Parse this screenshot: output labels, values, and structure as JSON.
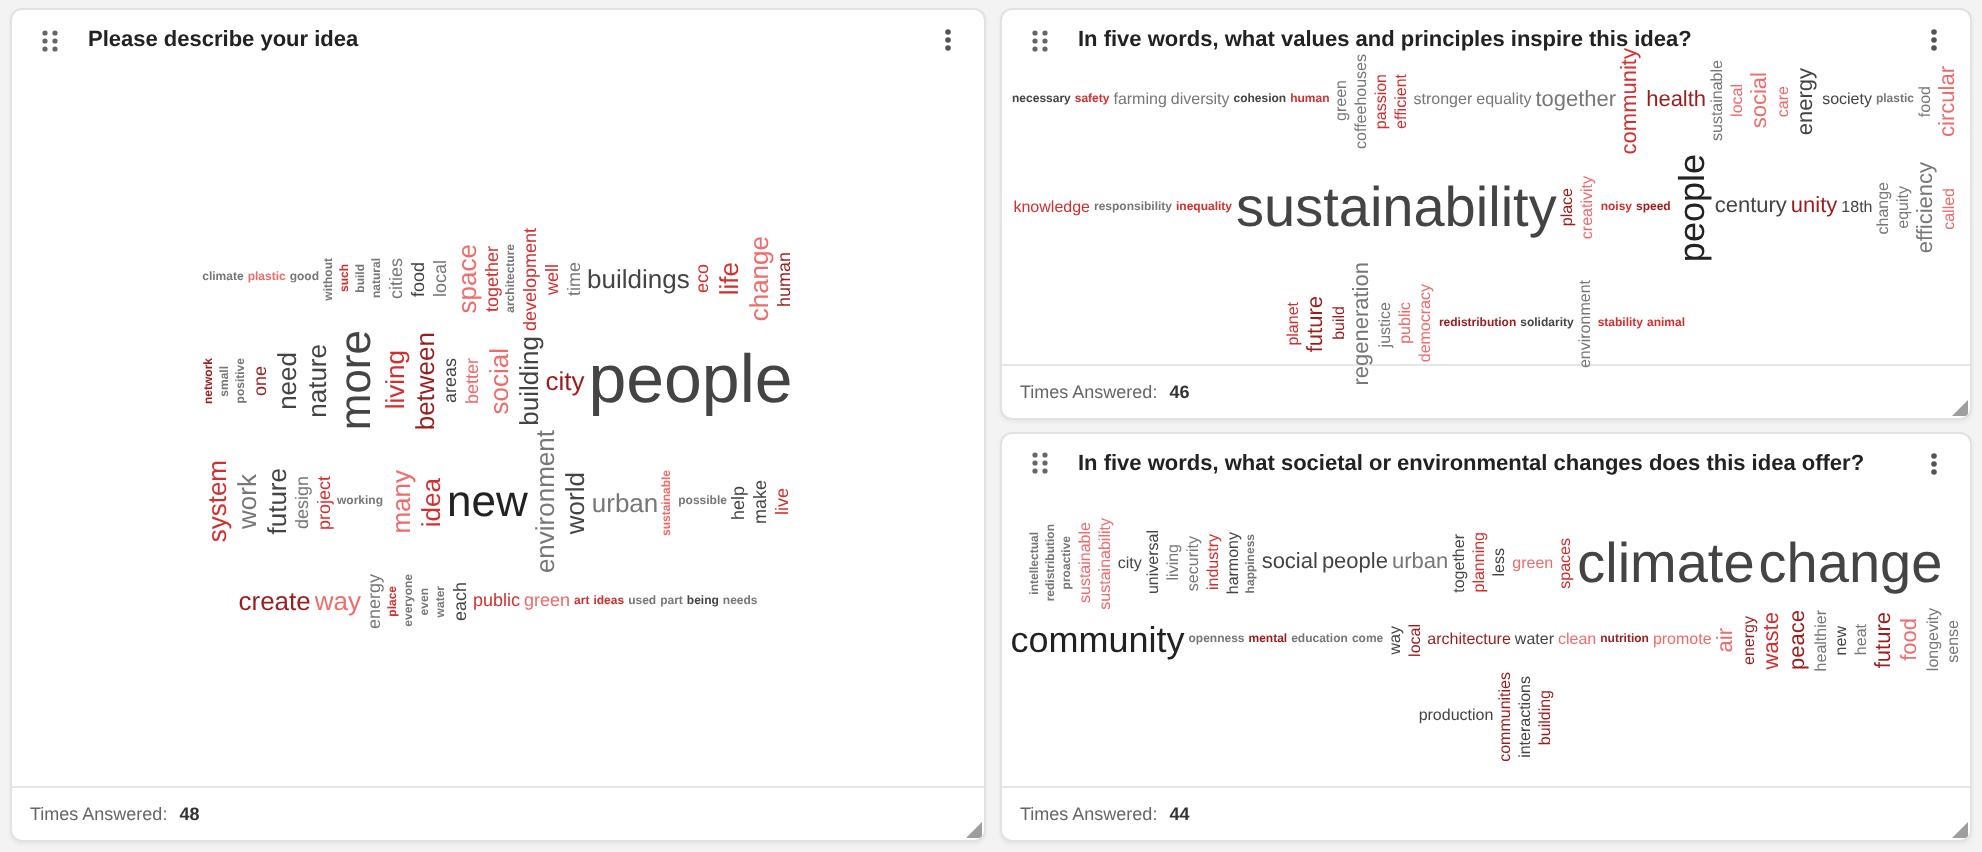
{
  "cards": [
    {
      "title": "Please describe your idea",
      "answered_label": "Times Answered:",
      "answered_count": "48",
      "words": [
        {
          "text": "climate",
          "kind": "xs",
          "vertical": false,
          "color": "#777777"
        },
        {
          "text": "plastic",
          "kind": "xs",
          "vertical": false,
          "color": "#ef6c6c"
        },
        {
          "text": "good",
          "kind": "xs",
          "vertical": false,
          "color": "#777777"
        },
        {
          "text": "without",
          "kind": "xs",
          "vertical": true,
          "color": "#777777"
        },
        {
          "text": "such",
          "kind": "xs",
          "vertical": true,
          "color": "#d32f2f"
        },
        {
          "text": "build",
          "kind": "xs",
          "vertical": true,
          "color": "#777777"
        },
        {
          "text": "natural",
          "kind": "xs",
          "vertical": true,
          "color": "#777777"
        },
        {
          "text": "cities",
          "kind": "s",
          "vertical": true,
          "color": "#777777"
        },
        {
          "text": "food",
          "kind": "s",
          "vertical": true,
          "color": "#444444"
        },
        {
          "text": "local",
          "kind": "s",
          "vertical": true,
          "color": "#777777"
        },
        {
          "text": "space",
          "kind": "m",
          "vertical": true,
          "color": "#ef6c6c"
        },
        {
          "text": "together",
          "kind": "s",
          "vertical": true,
          "color": "#d32f2f"
        },
        {
          "text": "architecture",
          "kind": "xs",
          "vertical": true,
          "color": "#777777"
        },
        {
          "text": "development",
          "kind": "s",
          "vertical": true,
          "color": "#d32f2f"
        },
        {
          "text": "well",
          "kind": "s",
          "vertical": true,
          "color": "#d32f2f"
        },
        {
          "text": "time",
          "kind": "s",
          "vertical": true,
          "color": "#777777"
        },
        {
          "text": "buildings",
          "kind": "m",
          "vertical": false,
          "color": "#444444"
        },
        {
          "text": "eco",
          "kind": "s",
          "vertical": true,
          "color": "#d32f2f"
        },
        {
          "text": "life",
          "kind": "m",
          "vertical": true,
          "color": "#d32f2f"
        },
        {
          "text": "change",
          "kind": "m",
          "vertical": true,
          "color": "#ef6c6c"
        },
        {
          "text": "human",
          "kind": "s",
          "vertical": true,
          "color": "#9b1c1c"
        },
        {
          "text": "network",
          "kind": "xs",
          "vertical": true,
          "color": "#9b1c1c"
        },
        {
          "text": "small",
          "kind": "xs",
          "vertical": true,
          "color": "#777777"
        },
        {
          "text": "positive",
          "kind": "xs",
          "vertical": true,
          "color": "#777777"
        },
        {
          "text": "one",
          "kind": "s",
          "vertical": true,
          "color": "#9b1c1c"
        },
        {
          "text": "need",
          "kind": "m",
          "vertical": true,
          "color": "#444444"
        },
        {
          "text": "nature",
          "kind": "m",
          "vertical": true,
          "color": "#444444"
        },
        {
          "text": "more",
          "kind": "l",
          "vertical": true,
          "color": "#444444"
        },
        {
          "text": "living",
          "kind": "m",
          "vertical": true,
          "color": "#d32f2f"
        },
        {
          "text": "between",
          "kind": "m",
          "vertical": true,
          "color": "#9b1c1c"
        },
        {
          "text": "areas",
          "kind": "s",
          "vertical": true,
          "color": "#444444"
        },
        {
          "text": "better",
          "kind": "s",
          "vertical": true,
          "color": "#ef6c6c"
        },
        {
          "text": "social",
          "kind": "m",
          "vertical": true,
          "color": "#ef6c6c"
        },
        {
          "text": "building",
          "kind": "m",
          "vertical": true,
          "color": "#444444"
        },
        {
          "text": "city",
          "kind": "m",
          "vertical": false,
          "color": "#9b1c1c"
        },
        {
          "text": "people",
          "kind": "xl",
          "vertical": false,
          "color": "#444444"
        },
        {
          "text": "system",
          "kind": "m",
          "vertical": true,
          "color": "#d32f2f"
        },
        {
          "text": "work",
          "kind": "m",
          "vertical": true,
          "color": "#777777"
        },
        {
          "text": "future",
          "kind": "m",
          "vertical": true,
          "color": "#444444"
        },
        {
          "text": "design",
          "kind": "s",
          "vertical": true,
          "color": "#777777"
        },
        {
          "text": "project",
          "kind": "s",
          "vertical": true,
          "color": "#d32f2f"
        },
        {
          "text": "working",
          "kind": "xs",
          "vertical": false,
          "color": "#777777"
        },
        {
          "text": "many",
          "kind": "m",
          "vertical": true,
          "color": "#ef6c6c"
        },
        {
          "text": "idea",
          "kind": "m",
          "vertical": true,
          "color": "#d32f2f"
        },
        {
          "text": "new",
          "kind": "l",
          "vertical": false,
          "color": "#222222"
        },
        {
          "text": "environment",
          "kind": "m",
          "vertical": true,
          "color": "#777777"
        },
        {
          "text": "world",
          "kind": "m",
          "vertical": true,
          "color": "#444444"
        },
        {
          "text": "urban",
          "kind": "m",
          "vertical": false,
          "color": "#777777"
        },
        {
          "text": "sustainable",
          "kind": "xs",
          "vertical": true,
          "color": "#ef6c6c"
        },
        {
          "text": "possible",
          "kind": "xs",
          "vertical": false,
          "color": "#777777"
        },
        {
          "text": "help",
          "kind": "s",
          "vertical": true,
          "color": "#444444"
        },
        {
          "text": "make",
          "kind": "s",
          "vertical": true,
          "color": "#444444"
        },
        {
          "text": "live",
          "kind": "s",
          "vertical": true,
          "color": "#d32f2f"
        },
        {
          "text": "create",
          "kind": "m",
          "vertical": false,
          "color": "#9b1c1c"
        },
        {
          "text": "way",
          "kind": "m",
          "vertical": false,
          "color": "#ef6c6c"
        },
        {
          "text": "energy",
          "kind": "s",
          "vertical": true,
          "color": "#777777"
        },
        {
          "text": "place",
          "kind": "xs",
          "vertical": true,
          "color": "#d32f2f"
        },
        {
          "text": "everyone",
          "kind": "xs",
          "vertical": true,
          "color": "#777777"
        },
        {
          "text": "even",
          "kind": "xs",
          "vertical": true,
          "color": "#777777"
        },
        {
          "text": "water",
          "kind": "xs",
          "vertical": true,
          "color": "#777777"
        },
        {
          "text": "each",
          "kind": "s",
          "vertical": true,
          "color": "#444444"
        },
        {
          "text": "public",
          "kind": "s",
          "vertical": false,
          "color": "#d32f2f"
        },
        {
          "text": "green",
          "kind": "s",
          "vertical": false,
          "color": "#ef6c6c"
        },
        {
          "text": "art",
          "kind": "xs",
          "vertical": false,
          "color": "#d32f2f"
        },
        {
          "text": "ideas",
          "kind": "xs",
          "vertical": false,
          "color": "#d32f2f"
        },
        {
          "text": "used",
          "kind": "xs",
          "vertical": false,
          "color": "#777777"
        },
        {
          "text": "part",
          "kind": "xs",
          "vertical": false,
          "color": "#777777"
        },
        {
          "text": "being",
          "kind": "xs",
          "vertical": false,
          "color": "#444444"
        },
        {
          "text": "needs",
          "kind": "xs",
          "vertical": false,
          "color": "#777777"
        }
      ]
    },
    {
      "title": "In five words, what values and principles inspire this idea?",
      "answered_label": "Times Answered:",
      "answered_count": "46",
      "words": [
        {
          "text": "necessary",
          "kind": "xs",
          "vertical": false,
          "color": "#444444"
        },
        {
          "text": "safety",
          "kind": "xs",
          "vertical": false,
          "color": "#d32f2f"
        },
        {
          "text": "farming",
          "kind": "s",
          "vertical": false,
          "color": "#777777"
        },
        {
          "text": "diversity",
          "kind": "s",
          "vertical": false,
          "color": "#777777"
        },
        {
          "text": "cohesion",
          "kind": "xs",
          "vertical": false,
          "color": "#444444"
        },
        {
          "text": "human",
          "kind": "xs",
          "vertical": false,
          "color": "#d32f2f"
        },
        {
          "text": "green",
          "kind": "s",
          "vertical": true,
          "color": "#777777"
        },
        {
          "text": "coffeehouses",
          "kind": "s",
          "vertical": true,
          "color": "#777777"
        },
        {
          "text": "passion",
          "kind": "s",
          "vertical": true,
          "color": "#d32f2f"
        },
        {
          "text": "efficient",
          "kind": "s",
          "vertical": true,
          "color": "#d32f2f"
        },
        {
          "text": "stronger",
          "kind": "s",
          "vertical": false,
          "color": "#777777"
        },
        {
          "text": "equality",
          "kind": "s",
          "vertical": false,
          "color": "#777777"
        },
        {
          "text": "together",
          "kind": "m",
          "vertical": false,
          "color": "#777777"
        },
        {
          "text": "community",
          "kind": "m",
          "vertical": true,
          "color": "#d32f2f"
        },
        {
          "text": "health",
          "kind": "m",
          "vertical": false,
          "color": "#9b1c1c"
        },
        {
          "text": "sustainable",
          "kind": "s",
          "vertical": true,
          "color": "#777777"
        },
        {
          "text": "local",
          "kind": "s",
          "vertical": true,
          "color": "#ef6c6c"
        },
        {
          "text": "social",
          "kind": "m",
          "vertical": true,
          "color": "#ef6c6c"
        },
        {
          "text": "care",
          "kind": "s",
          "vertical": true,
          "color": "#ef6c6c"
        },
        {
          "text": "energy",
          "kind": "m",
          "vertical": true,
          "color": "#444444"
        },
        {
          "text": "society",
          "kind": "s",
          "vertical": false,
          "color": "#444444"
        },
        {
          "text": "plastic",
          "kind": "xs",
          "vertical": false,
          "color": "#777777"
        },
        {
          "text": "food",
          "kind": "s",
          "vertical": true,
          "color": "#777777"
        },
        {
          "text": "circular",
          "kind": "m",
          "vertical": true,
          "color": "#ef6c6c"
        },
        {
          "text": "knowledge",
          "kind": "s",
          "vertical": false,
          "color": "#d32f2f"
        },
        {
          "text": "responsibility",
          "kind": "xs",
          "vertical": false,
          "color": "#777777"
        },
        {
          "text": "inequality",
          "kind": "xs",
          "vertical": false,
          "color": "#d32f2f"
        },
        {
          "text": "sustainability",
          "kind": "xl",
          "vertical": false,
          "color": "#444444"
        },
        {
          "text": "place",
          "kind": "s",
          "vertical": true,
          "color": "#9b1c1c"
        },
        {
          "text": "creativity",
          "kind": "s",
          "vertical": true,
          "color": "#ef6c6c"
        },
        {
          "text": "noisy",
          "kind": "xs",
          "vertical": false,
          "color": "#d32f2f"
        },
        {
          "text": "speed",
          "kind": "xs",
          "vertical": false,
          "color": "#9b1c1c"
        },
        {
          "text": "people",
          "kind": "l",
          "vertical": true,
          "color": "#222222"
        },
        {
          "text": "century",
          "kind": "m",
          "vertical": false,
          "color": "#444444"
        },
        {
          "text": "unity",
          "kind": "m",
          "vertical": false,
          "color": "#9b1c1c"
        },
        {
          "text": "18th",
          "kind": "s",
          "vertical": false,
          "color": "#444444"
        },
        {
          "text": "change",
          "kind": "s",
          "vertical": true,
          "color": "#777777"
        },
        {
          "text": "equity",
          "kind": "s",
          "vertical": true,
          "color": "#777777"
        },
        {
          "text": "efficiency",
          "kind": "m",
          "vertical": true,
          "color": "#777777"
        },
        {
          "text": "called",
          "kind": "s",
          "vertical": true,
          "color": "#ef6c6c"
        },
        {
          "text": "planet",
          "kind": "s",
          "vertical": true,
          "color": "#d32f2f"
        },
        {
          "text": "future",
          "kind": "m",
          "vertical": true,
          "color": "#9b1c1c"
        },
        {
          "text": "build",
          "kind": "s",
          "vertical": true,
          "color": "#9b1c1c"
        },
        {
          "text": "regeneration",
          "kind": "m",
          "vertical": true,
          "color": "#777777"
        },
        {
          "text": "justice",
          "kind": "s",
          "vertical": true,
          "color": "#777777"
        },
        {
          "text": "public",
          "kind": "s",
          "vertical": true,
          "color": "#ef6c6c"
        },
        {
          "text": "democracy",
          "kind": "s",
          "vertical": true,
          "color": "#ef6c6c"
        },
        {
          "text": "redistribution",
          "kind": "xs",
          "vertical": false,
          "color": "#9b1c1c"
        },
        {
          "text": "solidarity",
          "kind": "xs",
          "vertical": false,
          "color": "#444444"
        },
        {
          "text": "environment",
          "kind": "s",
          "vertical": true,
          "color": "#777777"
        },
        {
          "text": "stability",
          "kind": "xs",
          "vertical": false,
          "color": "#d32f2f"
        },
        {
          "text": "animal",
          "kind": "xs",
          "vertical": false,
          "color": "#d32f2f"
        }
      ]
    },
    {
      "title": "In five words, what societal or environmental changes does this idea offer?",
      "answered_label": "Times Answered:",
      "answered_count": "44",
      "words": [
        {
          "text": "intellectual",
          "kind": "xs",
          "vertical": true,
          "color": "#777777"
        },
        {
          "text": "redistribution",
          "kind": "xs",
          "vertical": true,
          "color": "#777777"
        },
        {
          "text": "proactive",
          "kind": "xs",
          "vertical": true,
          "color": "#777777"
        },
        {
          "text": "sustainable",
          "kind": "s",
          "vertical": true,
          "color": "#ef6c6c"
        },
        {
          "text": "sustainability",
          "kind": "s",
          "vertical": true,
          "color": "#ef6c6c"
        },
        {
          "text": "city",
          "kind": "s",
          "vertical": false,
          "color": "#444444"
        },
        {
          "text": "universal",
          "kind": "s",
          "vertical": true,
          "color": "#444444"
        },
        {
          "text": "living",
          "kind": "s",
          "vertical": true,
          "color": "#777777"
        },
        {
          "text": "security",
          "kind": "s",
          "vertical": true,
          "color": "#777777"
        },
        {
          "text": "industry",
          "kind": "s",
          "vertical": true,
          "color": "#d32f2f"
        },
        {
          "text": "harmony",
          "kind": "s",
          "vertical": true,
          "color": "#444444"
        },
        {
          "text": "happiness",
          "kind": "xs",
          "vertical": true,
          "color": "#777777"
        },
        {
          "text": "social",
          "kind": "m",
          "vertical": false,
          "color": "#444444"
        },
        {
          "text": "people",
          "kind": "m",
          "vertical": false,
          "color": "#444444"
        },
        {
          "text": "urban",
          "kind": "m",
          "vertical": false,
          "color": "#777777"
        },
        {
          "text": "together",
          "kind": "s",
          "vertical": true,
          "color": "#444444"
        },
        {
          "text": "planning",
          "kind": "s",
          "vertical": true,
          "color": "#d32f2f"
        },
        {
          "text": "less",
          "kind": "s",
          "vertical": true,
          "color": "#444444"
        },
        {
          "text": "green",
          "kind": "s",
          "vertical": false,
          "color": "#ef6c6c"
        },
        {
          "text": "spaces",
          "kind": "s",
          "vertical": true,
          "color": "#d32f2f"
        },
        {
          "text": "climate",
          "kind": "xl",
          "vertical": false,
          "color": "#444444"
        },
        {
          "text": "change",
          "kind": "xl",
          "vertical": false,
          "color": "#444444"
        },
        {
          "text": "community",
          "kind": "l",
          "vertical": false,
          "color": "#222222"
        },
        {
          "text": "openness",
          "kind": "xs",
          "vertical": false,
          "color": "#777777"
        },
        {
          "text": "mental",
          "kind": "xs",
          "vertical": false,
          "color": "#9b1c1c"
        },
        {
          "text": "education",
          "kind": "xs",
          "vertical": false,
          "color": "#777777"
        },
        {
          "text": "come",
          "kind": "xs",
          "vertical": false,
          "color": "#777777"
        },
        {
          "text": "way",
          "kind": "s",
          "vertical": true,
          "color": "#444444"
        },
        {
          "text": "local",
          "kind": "s",
          "vertical": true,
          "color": "#9b1c1c"
        },
        {
          "text": "architecture",
          "kind": "s",
          "vertical": false,
          "color": "#9b1c1c"
        },
        {
          "text": "water",
          "kind": "s",
          "vertical": false,
          "color": "#444444"
        },
        {
          "text": "clean",
          "kind": "s",
          "vertical": false,
          "color": "#ef6c6c"
        },
        {
          "text": "nutrition",
          "kind": "xs",
          "vertical": false,
          "color": "#9b1c1c"
        },
        {
          "text": "promote",
          "kind": "s",
          "vertical": false,
          "color": "#ef6c6c"
        },
        {
          "text": "air",
          "kind": "m",
          "vertical": true,
          "color": "#ef6c6c"
        },
        {
          "text": "energy",
          "kind": "s",
          "vertical": true,
          "color": "#9b1c1c"
        },
        {
          "text": "waste",
          "kind": "m",
          "vertical": true,
          "color": "#d32f2f"
        },
        {
          "text": "peace",
          "kind": "m",
          "vertical": true,
          "color": "#9b1c1c"
        },
        {
          "text": "healthier",
          "kind": "s",
          "vertical": true,
          "color": "#777777"
        },
        {
          "text": "new",
          "kind": "s",
          "vertical": true,
          "color": "#444444"
        },
        {
          "text": "heat",
          "kind": "s",
          "vertical": true,
          "color": "#777777"
        },
        {
          "text": "future",
          "kind": "m",
          "vertical": true,
          "color": "#9b1c1c"
        },
        {
          "text": "food",
          "kind": "m",
          "vertical": true,
          "color": "#ef6c6c"
        },
        {
          "text": "longevity",
          "kind": "s",
          "vertical": true,
          "color": "#777777"
        },
        {
          "text": "sense",
          "kind": "s",
          "vertical": true,
          "color": "#777777"
        },
        {
          "text": "production",
          "kind": "s",
          "vertical": false,
          "color": "#444444"
        },
        {
          "text": "communities",
          "kind": "s",
          "vertical": true,
          "color": "#9b1c1c"
        },
        {
          "text": "interactions",
          "kind": "s",
          "vertical": true,
          "color": "#444444"
        },
        {
          "text": "building",
          "kind": "s",
          "vertical": true,
          "color": "#9b1c1c"
        }
      ]
    }
  ]
}
